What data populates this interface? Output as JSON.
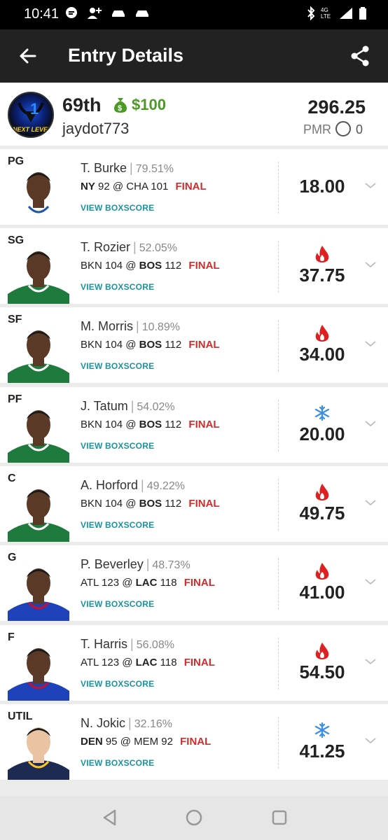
{
  "status_bar": {
    "time": "10:41",
    "network": "4G LTE"
  },
  "app_bar": {
    "title": "Entry Details"
  },
  "entry": {
    "rank": "69th",
    "prize": "$100",
    "username": "jaydot773",
    "avatar_text": "NEXT LEVEL",
    "total_score": "296.25",
    "pmr_label": "PMR",
    "pmr_value": "0"
  },
  "colors": {
    "accent_green": "#4a9a24",
    "final_red": "#d12c2c",
    "link_teal": "#1a93a0",
    "hot": "#e02020",
    "cold": "#3a8ee6"
  },
  "players": [
    {
      "pos": "PG",
      "name": "T. Burke",
      "pct": "79.51%",
      "away": "NY",
      "away_score": "92",
      "home": "CHA",
      "home_score": "101",
      "bold_team": "away",
      "status": "FINAL",
      "link": "VIEW BOXSCORE",
      "points": "18.00",
      "trend": "none",
      "jersey": "knicks"
    },
    {
      "pos": "SG",
      "name": "T. Rozier",
      "pct": "52.05%",
      "away": "BKN",
      "away_score": "104",
      "home": "BOS",
      "home_score": "112",
      "bold_team": "home",
      "status": "FINAL",
      "link": "VIEW BOXSCORE",
      "points": "37.75",
      "trend": "hot",
      "jersey": "celtics"
    },
    {
      "pos": "SF",
      "name": "M. Morris",
      "pct": "10.89%",
      "away": "BKN",
      "away_score": "104",
      "home": "BOS",
      "home_score": "112",
      "bold_team": "home",
      "status": "FINAL",
      "link": "VIEW BOXSCORE",
      "points": "34.00",
      "trend": "hot",
      "jersey": "celtics"
    },
    {
      "pos": "PF",
      "name": "J. Tatum",
      "pct": "54.02%",
      "away": "BKN",
      "away_score": "104",
      "home": "BOS",
      "home_score": "112",
      "bold_team": "home",
      "status": "FINAL",
      "link": "VIEW BOXSCORE",
      "points": "20.00",
      "trend": "cold",
      "jersey": "celtics"
    },
    {
      "pos": "C",
      "name": "A. Horford",
      "pct": "49.22%",
      "away": "BKN",
      "away_score": "104",
      "home": "BOS",
      "home_score": "112",
      "bold_team": "home",
      "status": "FINAL",
      "link": "VIEW BOXSCORE",
      "points": "49.75",
      "trend": "hot",
      "jersey": "celtics"
    },
    {
      "pos": "G",
      "name": "P. Beverley",
      "pct": "48.73%",
      "away": "ATL",
      "away_score": "123",
      "home": "LAC",
      "home_score": "118",
      "bold_team": "home",
      "status": "FINAL",
      "link": "VIEW BOXSCORE",
      "points": "41.00",
      "trend": "hot",
      "jersey": "clippers"
    },
    {
      "pos": "F",
      "name": "T. Harris",
      "pct": "56.08%",
      "away": "ATL",
      "away_score": "123",
      "home": "LAC",
      "home_score": "118",
      "bold_team": "home",
      "status": "FINAL",
      "link": "VIEW BOXSCORE",
      "points": "54.50",
      "trend": "hot",
      "jersey": "clippers"
    },
    {
      "pos": "UTIL",
      "name": "N. Jokic",
      "pct": "32.16%",
      "away": "DEN",
      "away_score": "95",
      "home": "MEM",
      "home_score": "92",
      "bold_team": "away",
      "status": "FINAL",
      "link": "VIEW BOXSCORE",
      "points": "41.25",
      "trend": "cold",
      "jersey": "nuggets"
    }
  ]
}
